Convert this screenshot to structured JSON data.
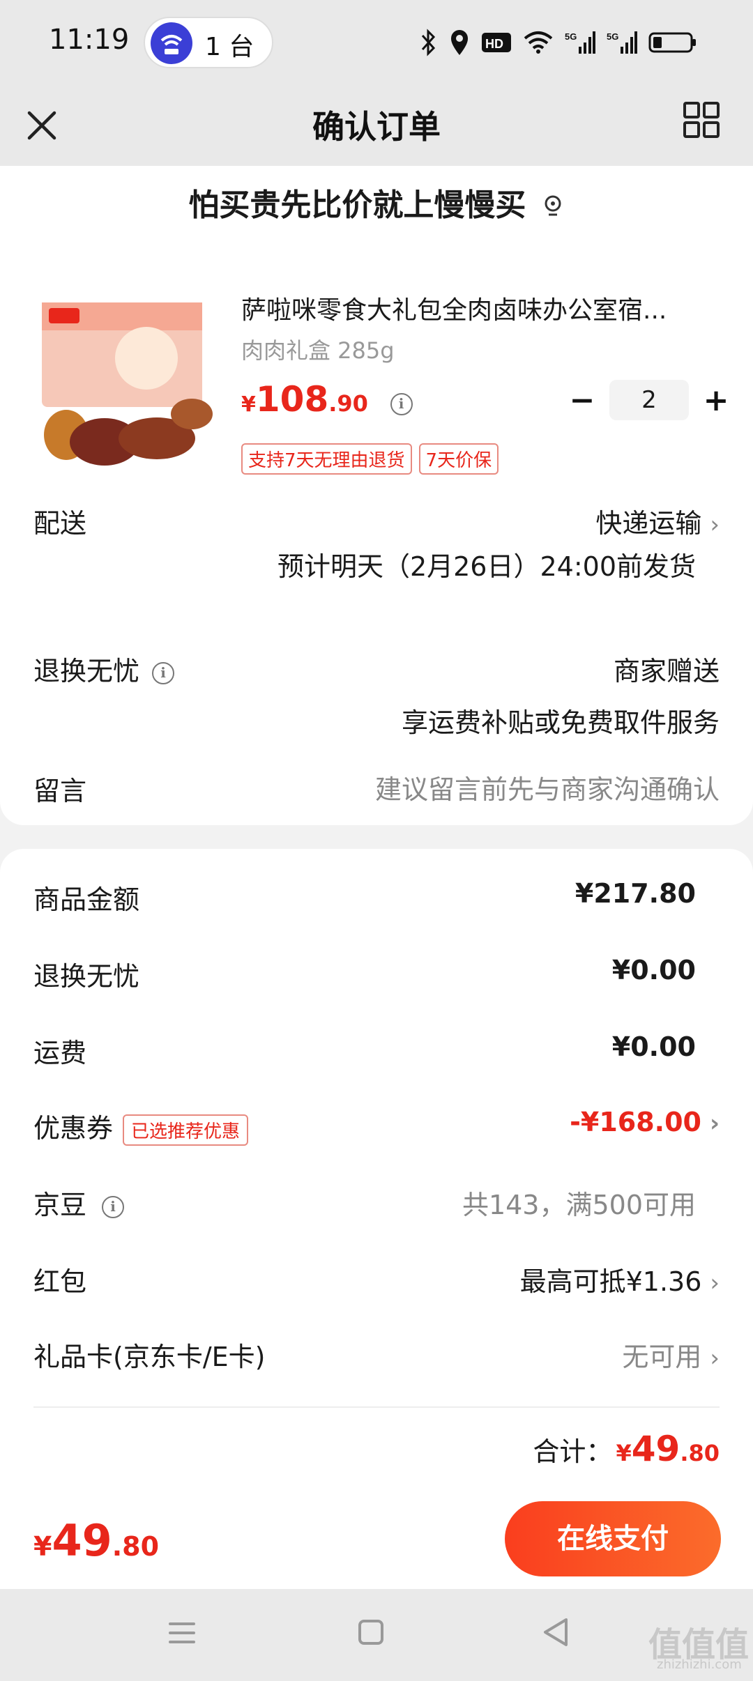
{
  "status_bar": {
    "time": "11:19",
    "hotspot_count": "1 台",
    "icons": [
      "bluetooth-icon",
      "location-icon",
      "hd-icon",
      "wifi-icon",
      "signal-5g-icon",
      "signal-5g-icon",
      "battery-icon"
    ]
  },
  "header": {
    "title": "确认订单"
  },
  "banner": {
    "text": "怕买贵先比价就上慢慢买"
  },
  "product": {
    "title": "萨啦咪零食大礼包全肉卤味办公室宿...",
    "spec": "肉肉礼盒 285g",
    "price_currency": "¥",
    "price_int": "108",
    "price_dec": ".90",
    "quantity": "2",
    "minus": "−",
    "plus": "+",
    "tags": [
      "支持7天无理由退货",
      "7天价保"
    ]
  },
  "delivery": {
    "label": "配送",
    "method": "快递运输",
    "estimate": "预计明天（2月26日）24:00前发货"
  },
  "worry_free": {
    "label": "退换无忧",
    "value": "商家赠送",
    "desc": "享运费补贴或免费取件服务"
  },
  "message": {
    "label": "留言",
    "placeholder": "建议留言前先与商家沟通确认"
  },
  "summary": {
    "goods_label": "商品金额",
    "goods_value": "¥217.80",
    "worry_label": "退换无忧",
    "worry_value": "¥0.00",
    "shipping_label": "运费",
    "shipping_value": "¥0.00",
    "coupon_label": "优惠券",
    "coupon_tag": "已选推荐优惠",
    "coupon_value": "-¥168.00",
    "jingdou_label": "京豆",
    "jingdou_value": "共143，满500可用",
    "redpacket_label": "红包",
    "redpacket_value": "最高可抵¥1.36",
    "giftcard_label": "礼品卡(京东卡/E卡)",
    "giftcard_value": "无可用",
    "total_label": "合计：",
    "total_currency": "¥",
    "total_int": "49",
    "total_dec": ".80"
  },
  "footer": {
    "currency": "¥",
    "total_int": "49",
    "total_dec": ".80",
    "pay_label": "在线支付"
  },
  "watermark": {
    "text": "值值值",
    "sub": "zhizhizhi.com"
  },
  "colors": {
    "accent_red": "#e8261b",
    "pay_gradient_start": "#fa3e1e",
    "pay_gradient_end": "#fb6c2b"
  }
}
